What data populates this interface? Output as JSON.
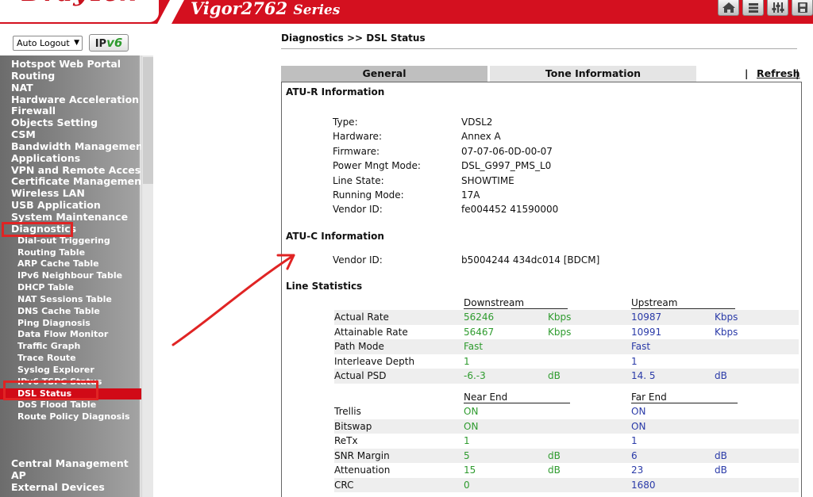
{
  "header": {
    "brand": "DrayTek",
    "model": "Vigor2762",
    "series": "Series",
    "icons": [
      "home-icon",
      "menu-icon",
      "settings-sliders-icon",
      "save-icon"
    ]
  },
  "sidebar": {
    "auto_logout": "Auto Logout",
    "ipv6_label_a": "IP",
    "ipv6_label_b": "v6",
    "items": [
      {
        "label": "Hotspot Web Portal",
        "sub": false
      },
      {
        "label": "Routing",
        "sub": false
      },
      {
        "label": "NAT",
        "sub": false
      },
      {
        "label": "Hardware Acceleration",
        "sub": false
      },
      {
        "label": "Firewall",
        "sub": false
      },
      {
        "label": "Objects Setting",
        "sub": false
      },
      {
        "label": "CSM",
        "sub": false
      },
      {
        "label": "Bandwidth Management",
        "sub": false
      },
      {
        "label": "Applications",
        "sub": false
      },
      {
        "label": "VPN and Remote Access",
        "sub": false
      },
      {
        "label": "Certificate Management",
        "sub": false
      },
      {
        "label": "Wireless LAN",
        "sub": false
      },
      {
        "label": "USB Application",
        "sub": false
      },
      {
        "label": "System Maintenance",
        "sub": false
      },
      {
        "label": "Diagnostics",
        "sub": false
      },
      {
        "label": "Dial-out Triggering",
        "sub": true
      },
      {
        "label": "Routing Table",
        "sub": true
      },
      {
        "label": "ARP Cache Table",
        "sub": true
      },
      {
        "label": "IPv6 Neighbour Table",
        "sub": true
      },
      {
        "label": "DHCP Table",
        "sub": true
      },
      {
        "label": "NAT Sessions Table",
        "sub": true
      },
      {
        "label": "DNS Cache Table",
        "sub": true
      },
      {
        "label": "Ping Diagnosis",
        "sub": true
      },
      {
        "label": "Data Flow Monitor",
        "sub": true
      },
      {
        "label": "Traffic Graph",
        "sub": true
      },
      {
        "label": "Trace Route",
        "sub": true
      },
      {
        "label": "Syslog Explorer",
        "sub": true
      },
      {
        "label": "IPv6 TSPC Status",
        "sub": true
      },
      {
        "label": "DSL Status",
        "sub": true
      },
      {
        "label": "DoS Flood Table",
        "sub": true
      },
      {
        "label": "Route Policy Diagnosis",
        "sub": true
      }
    ],
    "bottom_items": [
      "Central Management",
      "AP",
      "External Devices"
    ]
  },
  "page": {
    "breadcrumb": "Diagnostics >> DSL Status",
    "tabs": {
      "general": "General",
      "tone": "Tone Information"
    },
    "pipe": "|",
    "refresh": "Refresh",
    "atur": {
      "title": "ATU-R Information",
      "rows": [
        {
          "k": "Type:",
          "v": "VDSL2"
        },
        {
          "k": "Hardware:",
          "v": "Annex A"
        },
        {
          "k": "Firmware:",
          "v": "07-07-06-0D-00-07"
        },
        {
          "k": "Power Mngt Mode:",
          "v": "DSL_G997_PMS_L0"
        },
        {
          "k": "Line State:",
          "v": "SHOWTIME"
        },
        {
          "k": "Running Mode:",
          "v": "17A"
        },
        {
          "k": "Vendor ID:",
          "v": "fe004452 41590000"
        }
      ]
    },
    "atuc": {
      "title": "ATU-C Information",
      "rows": [
        {
          "k": "Vendor ID:",
          "v": "b5004244 434dc014 [BDCM]"
        }
      ]
    },
    "line_stats": {
      "title": "Line Statistics",
      "group1": {
        "left": "Downstream",
        "right": "Upstream"
      },
      "rows1": [
        {
          "label": "Actual Rate",
          "dv": "56246",
          "du": "Kbps",
          "uv": "10987",
          "uu": "Kbps"
        },
        {
          "label": "Attainable Rate",
          "dv": "56467",
          "du": "Kbps",
          "uv": "10991",
          "uu": "Kbps"
        },
        {
          "label": "Path Mode",
          "dv": "Fast",
          "du": "",
          "uv": "Fast",
          "uu": ""
        },
        {
          "label": "Interleave Depth",
          "dv": "1",
          "du": "",
          "uv": "1",
          "uu": ""
        },
        {
          "label": "Actual PSD",
          "dv": "-6.-3",
          "du": "dB",
          "uv": "14. 5",
          "uu": "dB"
        }
      ],
      "group2": {
        "left": "Near End",
        "right": "Far End"
      },
      "rows2": [
        {
          "label": "Trellis",
          "dv": "ON",
          "du": "",
          "uv": "ON",
          "uu": ""
        },
        {
          "label": "Bitswap",
          "dv": "ON",
          "du": "",
          "uv": "ON",
          "uu": ""
        },
        {
          "label": "ReTx",
          "dv": "1",
          "du": "",
          "uv": "1",
          "uu": ""
        },
        {
          "label": "SNR Margin",
          "dv": "5",
          "du": "dB",
          "uv": "6",
          "uu": "dB"
        },
        {
          "label": "Attenuation",
          "dv": "15",
          "du": "dB",
          "uv": "23",
          "uu": "dB"
        },
        {
          "label": "CRC",
          "dv": "0",
          "du": "",
          "uv": "1680",
          "uu": ""
        }
      ]
    }
  },
  "colors": {
    "brand_red": "#d4101f",
    "highlight_red": "#e02424",
    "value_green": "#2e9b2e",
    "value_blue": "#2a3aa8"
  }
}
